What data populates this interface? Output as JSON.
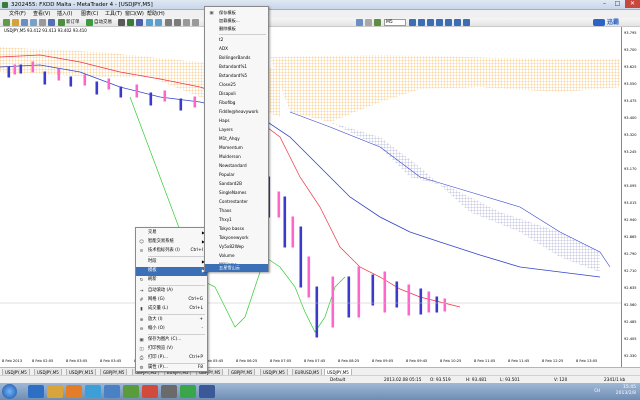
{
  "window": {
    "title": "3202455: FXDD Malta - MetaTrader 4 - [USDJPY,M5]",
    "buttons": {
      "minimize": "–",
      "maximize": "□",
      "close": "✕"
    }
  },
  "menubar": {
    "items": [
      "文件(F)",
      "查看(V)",
      "插入(I)",
      "图表(C)",
      "工具(T)",
      "窗口(W)",
      "帮助(H)"
    ]
  },
  "toolbar": {
    "new_order_label": "新订单",
    "auto_trade_label": "自动交易",
    "timeframe_select": "M5",
    "brand": "迅霸"
  },
  "chart": {
    "header": "USDJPY,M5  93.412 93.413 93.402 93.410",
    "price_labels": [
      "93.795",
      "93.700",
      "93.625",
      "93.550",
      "93.475",
      "93.400",
      "93.320",
      "93.245",
      "93.170",
      "93.095",
      "93.015",
      "92.940",
      "92.865",
      "92.790",
      "92.710",
      "92.635",
      "92.560",
      "92.485",
      "92.405",
      "92.330"
    ],
    "time_labels": [
      "8 Feb 2013",
      "8 Feb 02:05",
      "8 Feb 03:05",
      "8 Feb 03:45",
      "8 Feb 04:25",
      "8 Feb 05:05",
      "8 Feb 05:45",
      "8 Feb 06:25",
      "8 Feb 07:05",
      "8 Feb 07:45",
      "8 Feb 08:25",
      "8 Feb 09:05",
      "8 Feb 09:45",
      "8 Feb 10:25",
      "8 Feb 11:05",
      "8 Feb 11:45",
      "8 Feb 12:25",
      "8 Feb 13:05"
    ]
  },
  "context_menu": {
    "items": [
      {
        "label": "交易",
        "shortcut": "",
        "icon": "",
        "submenu": true
      },
      {
        "label": "智能交易系统",
        "shortcut": "",
        "icon": "",
        "submenu": true
      },
      {
        "label": "技术指标列表 (I)",
        "shortcut": "Ctrl+I",
        "icon": "",
        "submenu": false
      },
      {
        "label": "时段",
        "shortcut": "",
        "icon": "",
        "submenu": true
      },
      {
        "label": "模板",
        "shortcut": "",
        "icon": "",
        "submenu": true
      },
      {
        "label": "刷新",
        "shortcut": "",
        "icon": "",
        "submenu": false
      },
      {
        "label": "自动滚动 (A)",
        "shortcut": "",
        "icon": "",
        "submenu": false
      },
      {
        "label": "网格 (G)",
        "shortcut": "Ctrl+G",
        "icon": "",
        "submenu": false
      },
      {
        "label": "成交量 (L)",
        "shortcut": "Ctrl+L",
        "icon": "",
        "submenu": false
      },
      {
        "label": "放大 (I)",
        "shortcut": "+",
        "icon": "",
        "submenu": false
      },
      {
        "label": "缩小 (O)",
        "shortcut": "-",
        "icon": "",
        "submenu": false
      },
      {
        "label": "保存为图片 (C)...",
        "shortcut": "",
        "icon": "",
        "submenu": false
      },
      {
        "label": "打印预览 (V)",
        "shortcut": "",
        "icon": "",
        "submenu": false
      },
      {
        "label": "打印 (P)...",
        "shortcut": "Ctrl+P",
        "icon": "",
        "submenu": false
      },
      {
        "label": "属性 (P)...",
        "shortcut": "F8",
        "icon": "",
        "submenu": false
      }
    ]
  },
  "template_submenu": {
    "top": [
      "保存模板",
      "加载模板...",
      "删除模板"
    ],
    "templates": [
      "t2",
      "ADX",
      "BollingerBands",
      "Bstandard%1",
      "Bstandard%5",
      "Close25",
      "Disapoli",
      "Fibofibg",
      "Fiddle@heavywork",
      "Haps",
      "Layers",
      "M1t_Ahqy",
      "Momentum",
      "Mulderson",
      "Newstandard",
      "Popular",
      "Sandard2B",
      "SingleNames",
      "Contrestanter",
      "Thaxs",
      "Thxy1",
      "Tokyo bassx",
      "Tokyonewyork",
      "Vy5x82Wep",
      "Volume",
      "Williams",
      "五星雪山云"
    ]
  },
  "tabs": [
    "USDJPY,M5",
    "USDJPY,M5",
    "USDJPY,M15",
    "GBPJPY,M5",
    "GBPJPY,M5",
    "EURJPY,M5",
    "GBPJPY,M5",
    "GBPJPY,M5",
    "USDJPY,M5",
    "EURUSD,M5",
    "USDJPY,M5"
  ],
  "statusbar": {
    "profile": "Default",
    "datetime": "2013.02.08 05:15",
    "open": "O: 93.519",
    "high": "H: 93.481",
    "low": "L: 93.501",
    "volume": "V: 120",
    "traffic": "2341/1 kb"
  },
  "taskbar": {
    "time": "15:45",
    "date": "2013/2/8",
    "tray": "CH"
  },
  "colors": {
    "cloud": "#f4a83a",
    "kijun": "#3344cc",
    "tenkan": "#ee3344",
    "chikou": "#33cc33",
    "bull": "#ff66cc",
    "bear": "#3a3acc",
    "menu_highlight": "#3b6fb6"
  }
}
